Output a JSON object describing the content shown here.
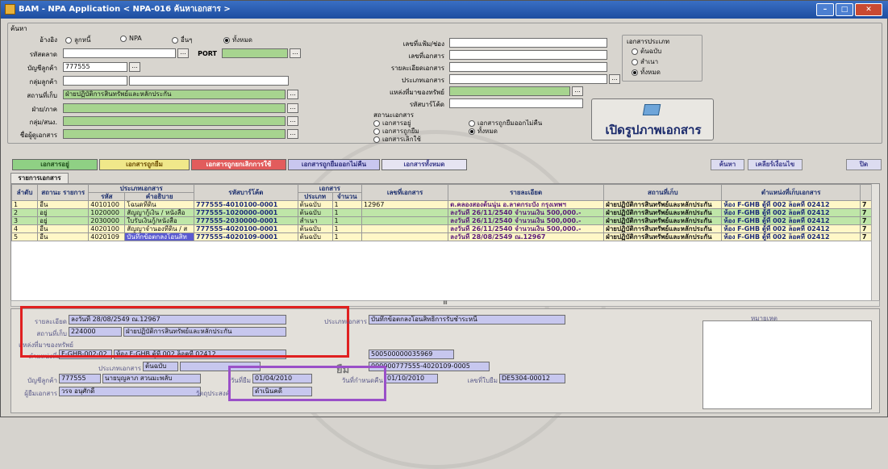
{
  "window": {
    "title": "BAM - NPA Application < NPA-016 ค้นหาเอกสาร >",
    "min_label": "–",
    "max_label": "□",
    "close_label": "✕"
  },
  "search_section": {
    "group_label": "ค้นหา",
    "selector_label": "อ้างอิง",
    "selector_options": [
      "ลูกหนี้",
      "NPA",
      "อื่นๆ",
      "ทั้งหมด"
    ],
    "selected_option": "ทั้งหมด",
    "port_label": "PORT",
    "left_fields": [
      {
        "label": "รหัสตลาด",
        "value": ""
      },
      {
        "label": "บัญชีลูกค้า",
        "value": "777555"
      },
      {
        "label": "กลุ่มลูกค้า",
        "value": ""
      },
      {
        "label": "สถานที่เก็บ",
        "value": "ฝ่ายปฏิบัติการสินทรัพย์และหลักประกัน"
      },
      {
        "label": "ฝ่าย/ภาค",
        "value": ""
      },
      {
        "label": "กลุ่ม/สนง.",
        "value": ""
      },
      {
        "label": "ชื่อผู้ดูเอกสาร",
        "value": ""
      }
    ],
    "mid_fields": [
      {
        "label": "เลขที่แฟ้ม/ช่อง",
        "value": ""
      },
      {
        "label": "เลขที่เอกสาร",
        "value": ""
      },
      {
        "label": "รายละเอียดเอกสาร",
        "value": ""
      },
      {
        "label": "ประเภทเอกสาร",
        "value": ""
      },
      {
        "label": "แหล่งที่มาของทรัพย์",
        "value": ""
      },
      {
        "label": "รหัสบาร์โค้ด",
        "value": ""
      }
    ],
    "status_label": "สถานะเอกสาร",
    "status_options": [
      "เอกสารอยู่",
      "เอกสารถูกยืม",
      "เอกสารเลิกใช้",
      "เอกสารถูกยืมออกไม่คืน",
      "ทั้งหมด"
    ],
    "status_selected": "ทั้งหมด",
    "doctype_label": "เอกสารประเภท",
    "doctype_options": [
      "ต้นฉบับ",
      "สำเนา",
      "ทั้งหมด"
    ],
    "doctype_selected": "ทั้งหมด",
    "open_image_button": "เปิดรูปภาพเอกสาร"
  },
  "filter_tabs": [
    "เอกสารอยู่",
    "เอกสารถูกยืม",
    "เอกสารถูกยกเลิกการใช้",
    "เอกสารถูกยืมออกไม่คืน",
    "เอกสารทั้งหมด"
  ],
  "action_buttons": {
    "search": "ค้นหา",
    "clear": "เคลียร์เงื่อนไข",
    "close": "ปิด"
  },
  "list_tab": "รายการเอกสาร",
  "grid": {
    "group_headers": {
      "doctype": "ประเภทเอกสาร",
      "docs": "เอกสาร"
    },
    "headers": [
      "ลำดับ",
      "สถานะ รายการ",
      "รหัส",
      "คำอธิบาย",
      "รหัสบาร์โค้ด",
      "ประเภท",
      "จำนวน",
      "เลขที่เอกสาร",
      "รายละเอียด",
      "สถานที่เก็บ",
      "ตำแหน่งที่เก็บเอกสาร",
      ""
    ],
    "rows": [
      {
        "no": "1",
        "status": "อื่น",
        "code": "4010100",
        "desc": "โฉนดที่ดิน",
        "barcode": "777555-4010100-0001",
        "type": "ต้นฉบับ",
        "qty": "1",
        "docno": "12967",
        "detail": "ต.คลองสองต้นนุ่น อ.ลาดกระบัง กรุงเทพฯ",
        "store": "ฝ่ายปฏิบัติการสินทรัพย์และหลักประกัน",
        "loc": "ห้อง F-GHB ตู้ที่ 002 ล็อคที่ 02412",
        "x": "7"
      },
      {
        "no": "2",
        "status": "อยู่",
        "code": "1020000",
        "desc": "สัญญากู้เงิน / หนังสือ",
        "barcode": "777555-1020000-0001",
        "type": "ต้นฉบับ",
        "qty": "1",
        "docno": "",
        "detail": "ลงวันที่ 26/11/2540 จำนวนเงิน 500,000.-",
        "store": "ฝ่ายปฏิบัติการสินทรัพย์และหลักประกัน",
        "loc": "ห้อง F-GHB ตู้ที่ 002 ล็อคที่ 02412",
        "x": "7"
      },
      {
        "no": "3",
        "status": "อยู่",
        "code": "2030000",
        "desc": "ใบรับเงินกู้/หนังสือ",
        "barcode": "777555-2030000-0001",
        "type": "สำเนา",
        "qty": "1",
        "docno": "",
        "detail": "ลงวันที่ 26/11/2540 จำนวนเงิน 500,000.-",
        "store": "ฝ่ายปฏิบัติการสินทรัพย์และหลักประกัน",
        "loc": "ห้อง F-GHB ตู้ที่ 002 ล็อคที่ 02412",
        "x": "7"
      },
      {
        "no": "4",
        "status": "อื่น",
        "code": "4020100",
        "desc": "สัญญาจำนองที่ดิน / ส",
        "barcode": "777555-4020100-0001",
        "type": "ต้นฉบับ",
        "qty": "1",
        "docno": "",
        "detail": "ลงวันที่ 26/11/2540 จำนวนเงิน 500,000.-",
        "store": "ฝ่ายปฏิบัติการสินทรัพย์และหลักประกัน",
        "loc": "ห้อง F-GHB ตู้ที่ 002 ล็อคที่ 02412",
        "x": "7"
      },
      {
        "no": "5",
        "status": "อื่น",
        "code": "4020109",
        "desc": "บันทึกข้อตกลงโอนสิท",
        "barcode": "777555-4020109-0001",
        "type": "ต้นฉบับ",
        "qty": "1",
        "docno": "",
        "detail": "ลงวันที่ 28/08/2549 ณ.12967",
        "store": "ฝ่ายปฏิบัติการสินทรัพย์และหลักประกัน",
        "loc": "ห้อง F-GHB ตู้ที่ 002 ล็อคที่ 02412",
        "x": "7"
      }
    ]
  },
  "detail_panel": {
    "detail_label": "รายละเอียด",
    "detail_value": "ลงวันที่ 28/08/2549 ณ.12967",
    "store_label": "สถานที่เก็บ",
    "store_code": "224000",
    "store_name": "ฝ่ายปฏิบัติการสินทรัพย์และหลักประกัน",
    "loc_label": "ตำแหน่งที่เก็บ",
    "loc_value": "F-GHB-002-02",
    "loc_desc": "ห้อง F-GHB ตู้ที่ 002 ล็อคที่ 02412",
    "source_label": "แหล่งที่มาของทรัพย์",
    "doctype_label": "ประเภทเอกสาร",
    "doctype_value": "ต้นฉบับ",
    "account_label": "บัญชีลูกค้า",
    "account_code": "777555",
    "account_name": "นายบุญลาภ สวนมะพลับ",
    "borrower_label": "ผู้ยืมเอกสาร",
    "borrower_value": "วรจ อนุศักดิ์",
    "desc_label": "ประเภทเอกสาร",
    "desc_value": "บันทึกข้อตกลงโอนสิทธิการรับชำระหนี้",
    "ref1_value": "500500000035969",
    "ref2_value": "000000777555-4020109-0005",
    "borrow_date_label": "วันที่ยืม",
    "borrow_date": "01/04/2010",
    "return_date_label": "วันที่กำหนดคืน",
    "return_date": "01/10/2010",
    "receipt_label": "เลขที่ใบยืม",
    "receipt_value": "DE5304-00012",
    "purpose_label": "วัตถุประสงค์",
    "purpose_value": "ดำเนินคดี",
    "borrow_status_value": "ยืม",
    "note_label": "หมายเหตุ",
    "scroll_label": "III"
  }
}
